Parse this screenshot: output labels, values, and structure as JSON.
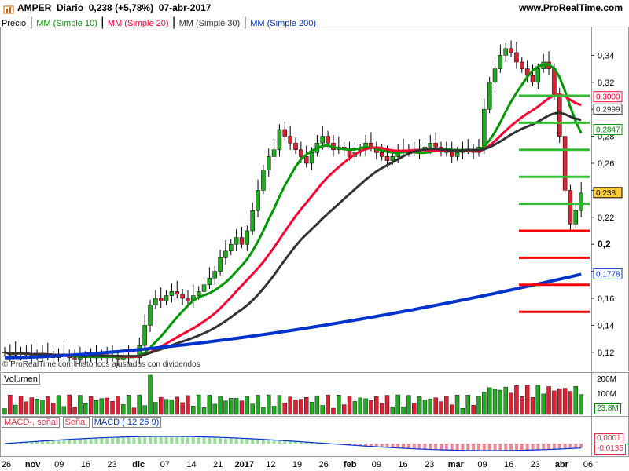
{
  "header": {
    "ticker": "AMPER",
    "period": "Diario",
    "quote": "0,238 (+5,78%)",
    "date": "07-abr-2017",
    "brand": "www.ProRealTime.com"
  },
  "legend": [
    {
      "label": "Precio",
      "color": "#000000"
    },
    {
      "label": "MM (Simple 10)",
      "color": "#009900"
    },
    {
      "label": "MM (Simple 20)",
      "color": "#ff0033"
    },
    {
      "label": "MM (Simple 30)",
      "color": "#333333"
    },
    {
      "label": "MM (Simple 200)",
      "color": "#0033cc"
    }
  ],
  "watermark": "© ProRealTime.com Históricos ajustados con dividendos",
  "volume_panel": {
    "label": "Volumen",
    "last_value": "23,8M",
    "ticks": [
      "200M",
      "100M",
      "0"
    ]
  },
  "macd_panel": {
    "labels": [
      "MACD-, señal",
      "Señal",
      "MACD ( 12 26 9)"
    ],
    "values": [
      "0,0001",
      "-0,0135"
    ]
  },
  "x_axis_labels": [
    "26",
    "nov",
    "09",
    "16",
    "23",
    "dic",
    "07",
    "14",
    "21",
    "2017",
    "12",
    "19",
    "26",
    "feb",
    "09",
    "16",
    "23",
    "mar",
    "09",
    "16",
    "23",
    "abr",
    "06"
  ],
  "price_ticks": [
    "0,34",
    "0,32",
    "0,30",
    "0,28",
    "0,26",
    "0,24",
    "0,22",
    "0,2",
    "0,18",
    "0,16",
    "0,14",
    "0,12"
  ],
  "price_labels": [
    {
      "text": "0,3090",
      "value": 0.309,
      "color": "#ff0033",
      "bg": "#ffffff"
    },
    {
      "text": "0,2999",
      "value": 0.2999,
      "color": "#333333",
      "bg": "#ffffff"
    },
    {
      "text": "0,2847",
      "value": 0.2847,
      "color": "#009900",
      "bg": "#ffffff"
    },
    {
      "text": "0,238",
      "value": 0.238,
      "color": "#000000",
      "bg": "#ffcc33"
    },
    {
      "text": "0,1778",
      "value": 0.1778,
      "color": "#0033cc",
      "bg": "#ffffff"
    }
  ],
  "colors": {
    "up": "#22aa22",
    "down": "#dd2233",
    "ma10": "#009900",
    "ma20": "#ff0033",
    "ma30": "#333333",
    "ma200": "#0033cc",
    "support": "#ff0000",
    "resistance": "#33bb33"
  },
  "chart_data": {
    "type": "candlestick",
    "symbol": "AMPER",
    "period": "Diario",
    "date_range": [
      "2016-10-26",
      "2017-04-07"
    ],
    "last_close": 0.238,
    "change_pct": 5.78,
    "ylim": [
      0.11,
      0.36
    ],
    "closes": [
      0.12,
      0.118,
      0.12,
      0.119,
      0.118,
      0.117,
      0.118,
      0.119,
      0.117,
      0.116,
      0.117,
      0.118,
      0.116,
      0.115,
      0.116,
      0.117,
      0.116,
      0.117,
      0.118,
      0.117,
      0.116,
      0.115,
      0.116,
      0.117,
      0.116,
      0.125,
      0.14,
      0.155,
      0.16,
      0.158,
      0.162,
      0.165,
      0.163,
      0.16,
      0.158,
      0.162,
      0.165,
      0.17,
      0.175,
      0.18,
      0.19,
      0.195,
      0.2,
      0.205,
      0.2,
      0.21,
      0.225,
      0.24,
      0.255,
      0.265,
      0.27,
      0.285,
      0.28,
      0.275,
      0.27,
      0.265,
      0.26,
      0.268,
      0.275,
      0.28,
      0.275,
      0.27,
      0.272,
      0.27,
      0.265,
      0.268,
      0.27,
      0.275,
      0.272,
      0.268,
      0.265,
      0.262,
      0.265,
      0.268,
      0.27,
      0.27,
      0.268,
      0.27,
      0.272,
      0.275,
      0.272,
      0.27,
      0.268,
      0.265,
      0.268,
      0.27,
      0.27,
      0.268,
      0.272,
      0.3,
      0.32,
      0.33,
      0.34,
      0.345,
      0.342,
      0.335,
      0.33,
      0.325,
      0.32,
      0.33,
      0.335,
      0.33,
      0.31,
      0.28,
      0.24,
      0.215,
      0.225,
      0.238
    ],
    "ma10_end": 0.2847,
    "ma20_end": 0.309,
    "ma30_end": 0.2999,
    "ma200_end": 0.1778,
    "support_levels": [
      0.21,
      0.19,
      0.17,
      0.15
    ],
    "resistance_levels": [
      0.31,
      0.29,
      0.27,
      0.25,
      0.23
    ],
    "volume_last": "23,8M",
    "macd": {
      "macd": -0.0135,
      "signal": 0.0001
    }
  }
}
